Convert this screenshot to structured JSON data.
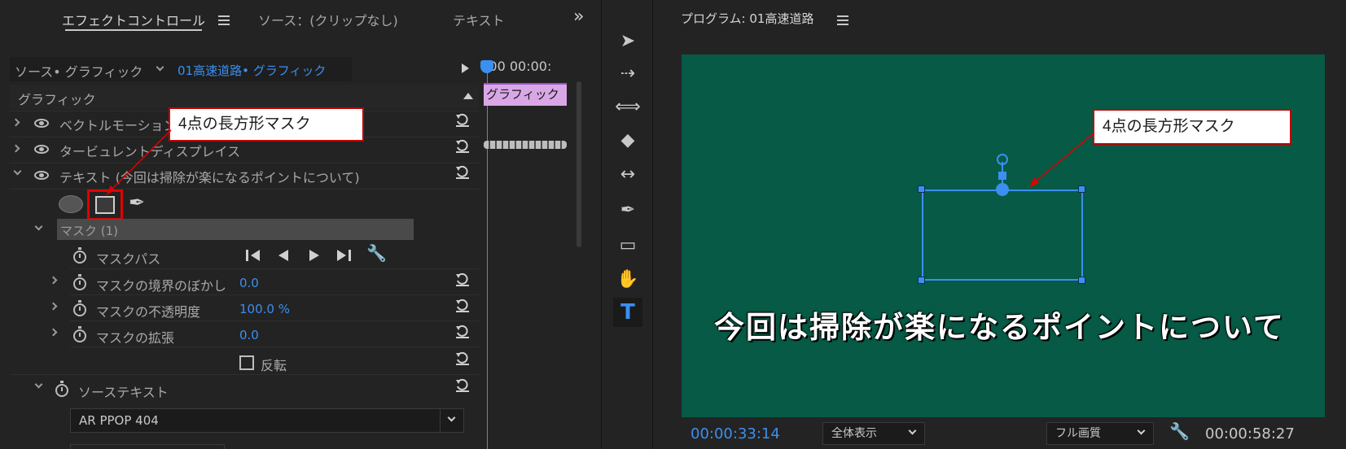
{
  "effect_controls": {
    "tabs": [
      {
        "label": "エフェクトコントロール",
        "active": true
      },
      {
        "label": "ソース：(クリップなし)",
        "active": false
      },
      {
        "label": "テキスト",
        "active": false
      }
    ],
    "overflow_label": "»",
    "source_label": "ソース• グラフィック",
    "sequence_label": "01高速道路• グラフィック",
    "timeline_times": ":00 00:00:",
    "clip_label": "グラフィック",
    "section_title": "グラフィック",
    "effects": [
      {
        "label": "ベクトルモーション"
      },
      {
        "label": "タービュレントディスプレイス"
      },
      {
        "label": "テキスト (今回は掃除が楽になるポイントについて)"
      }
    ],
    "mask_group": "マスク (1)",
    "mask_path_label": "マスクパス",
    "mask_props": [
      {
        "label": "マスクの境界のぼかし",
        "value": "0.0"
      },
      {
        "label": "マスクの不透明度",
        "value": "100.0 %"
      },
      {
        "label": "マスクの拡張",
        "value": "0.0"
      }
    ],
    "invert_label": "反転",
    "source_text_label": "ソーステキスト",
    "font_value": "AR PPOP 404",
    "callout": "4点の長方形マスク"
  },
  "tools": [
    {
      "name": "selection-tool",
      "glyph": "➤"
    },
    {
      "name": "track-select-tool",
      "glyph": "⇢"
    },
    {
      "name": "ripple-edit-tool",
      "glyph": "⟺"
    },
    {
      "name": "razor-tool",
      "glyph": "◆"
    },
    {
      "name": "slip-tool",
      "glyph": "↔"
    },
    {
      "name": "pen-tool",
      "glyph": "✒"
    },
    {
      "name": "rectangle-tool",
      "glyph": "▭"
    },
    {
      "name": "hand-tool",
      "glyph": "✋"
    },
    {
      "name": "type-tool",
      "glyph": "T"
    }
  ],
  "program": {
    "title": "プログラム: 01高速道路",
    "caption": "今回は掃除が楽になるポイントについて",
    "callout": "4点の長方形マスク",
    "current_time": "00:00:33:14",
    "zoom": "全体表示",
    "quality": "フル画質",
    "duration": "00:00:58:27"
  },
  "colors": {
    "accent_blue": "#3b8ff0",
    "video_bg": "#075a45",
    "callout_border": "#c00000",
    "clip_pink": "#d9a7e6"
  }
}
